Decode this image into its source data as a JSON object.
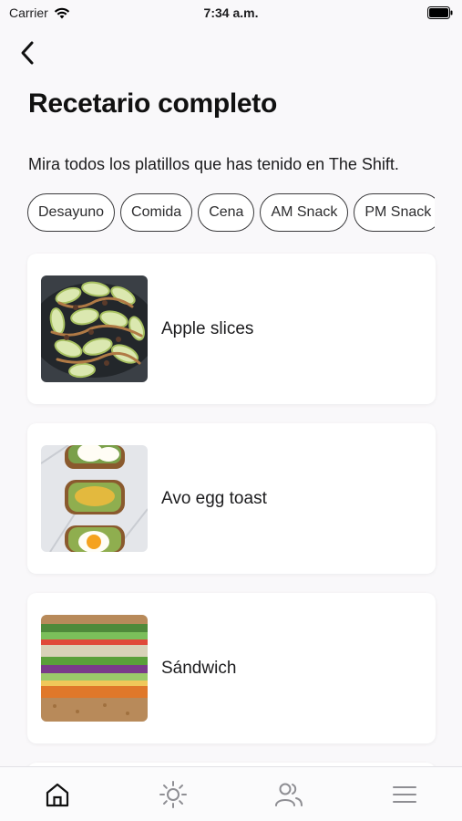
{
  "status_bar": {
    "carrier": "Carrier",
    "time": "7:34 a.m."
  },
  "header": {
    "back_icon": "chevron-left-icon",
    "title": "Recetario completo",
    "subtitle": "Mira todos los platillos que has tenido en The Shift."
  },
  "filters": [
    "Desayuno",
    "Comida",
    "Cena",
    "AM Snack",
    "PM Snack"
  ],
  "recipes": [
    {
      "name": "Apple slices",
      "image": "apple-slices-photo"
    },
    {
      "name": "Avo egg toast",
      "image": "avo-egg-toast-photo"
    },
    {
      "name": "Sándwich",
      "image": "sandwich-photo"
    }
  ],
  "tab_bar": [
    {
      "icon": "home-icon",
      "active": true
    },
    {
      "icon": "sun-icon",
      "active": false
    },
    {
      "icon": "users-icon",
      "active": false
    },
    {
      "icon": "menu-icon",
      "active": false
    }
  ],
  "colors": {
    "background": "#f9f8fa",
    "card": "#ffffff",
    "text": "#1c1c1e",
    "inactive_icon": "#8e8e93"
  }
}
